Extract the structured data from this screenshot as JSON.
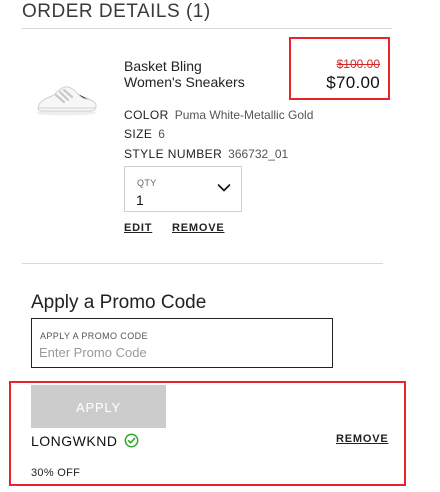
{
  "order": {
    "title": "ORDER DETAILS (1)"
  },
  "item": {
    "name_line1": "Basket Bling",
    "name_line2": "Women's Sneakers",
    "price_original": "$100.00",
    "price_sale": "$70.00",
    "color_label": "COLOR",
    "color_value": "Puma White-Metallic Gold",
    "size_label": "SIZE",
    "size_value": "6",
    "style_label": "STYLE NUMBER",
    "style_value": "366732_01",
    "qty_label": "QTY",
    "qty_value": "1",
    "edit_label": "EDIT",
    "remove_label": "REMOVE"
  },
  "promo": {
    "heading": "Apply a Promo Code",
    "input_label": "APPLY A PROMO CODE",
    "input_placeholder": "Enter Promo Code",
    "apply_label": "APPLY",
    "applied_code": "LONGWKND",
    "remove_label": "REMOVE",
    "discount": "30% OFF"
  },
  "colors": {
    "highlight": "#e8232a",
    "check": "#2aa82a",
    "sale_strike": "#d62a2a"
  }
}
